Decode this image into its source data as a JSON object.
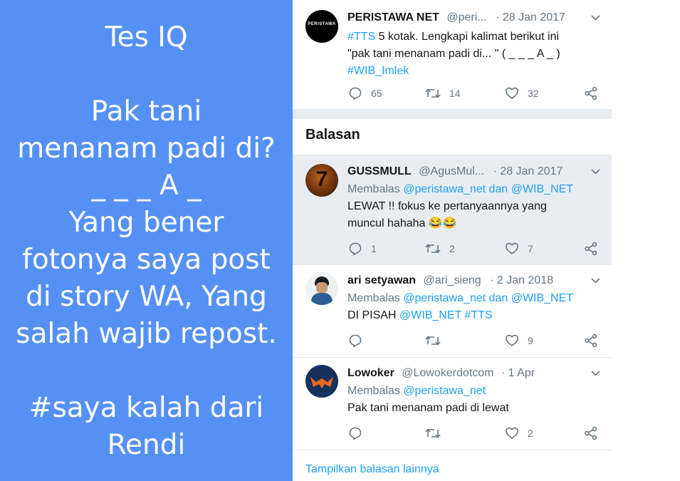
{
  "left_panel": {
    "lines": [
      "Tes IQ",
      "Pak tani",
      "menanam padi di?",
      "_ _ _ A _",
      "Yang bener",
      "fotonya saya post",
      "di story WA, Yang",
      "salah wajib repost.",
      "#saya kalah dari",
      "Rendi"
    ],
    "bg_color": "#5591f5"
  },
  "main_tweet": {
    "avatar_text": "PERISTAWA",
    "name": "PERISTAWA NET",
    "handle": "@peri...",
    "date": "· 28 Jan 2017",
    "hashtag1": "#TTS",
    "text1": " 5 kotak. Lengkapi kalimat berikut ini",
    "text2": "\"pak tani menanam padi di... \" ( _ _ _ A _ )",
    "hashtag2": "#WIB_Imlek",
    "replies": "65",
    "retweets": "14",
    "likes": "32"
  },
  "section_title": "Balasan",
  "replies": [
    {
      "name": "GUSSMULL",
      "handle": "@AgusMul...",
      "date": "· 28 Jan 2017",
      "reply_prefix": "Membalas ",
      "reply_to": "@peristawa_net dan @WIB_NET",
      "text1": "LEWAT !! fokus ke pertanyaannya yang",
      "text2": "muncul hahaha 😂😂",
      "replies": "1",
      "retweets": "2",
      "likes": "7"
    },
    {
      "name": "ari setyawan",
      "handle": "@ari_sieng",
      "date": "· 2 Jan 2018",
      "reply_prefix": "Membalas ",
      "reply_to": "@peristawa_net dan @WIB_NET",
      "text1": "DI PISAH ",
      "mention": "@WIB_NET",
      "hashtag": " #TTS",
      "likes": "9"
    },
    {
      "name": "Lowoker",
      "handle": "@Lowokerdotcom",
      "date": "· 1 Apr",
      "reply_prefix": "Membalas ",
      "reply_to": "@peristawa_net",
      "text1": "Pak tani menanam padi di lewat",
      "likes": "2"
    }
  ],
  "show_more": "Tampilkan balasan lainnya",
  "colors": {
    "link": "#1da1f2",
    "muted": "#657786",
    "text": "#14171a",
    "highlight_bg": "#e9edf1",
    "divider": "#e6ecf0"
  },
  "icons": [
    "reply-icon",
    "retweet-icon",
    "like-icon",
    "share-icon",
    "chevron-down-icon"
  ]
}
